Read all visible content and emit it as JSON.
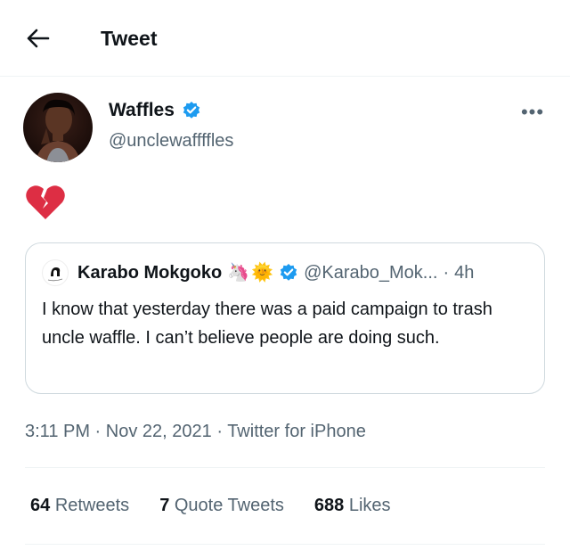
{
  "header": {
    "title": "Tweet",
    "back_icon": "arrow-left-icon"
  },
  "tweet": {
    "author": {
      "name": "Waffles",
      "handle": "@unclewaffffles",
      "verified": true
    },
    "text": "💔",
    "more_icon": "more-horizontal-icon",
    "more_label": "•••",
    "quote": {
      "name": "Karabo Mokgoko",
      "emojis": [
        "🦄",
        "🌞"
      ],
      "verified": true,
      "handle": "@Karabo_Mok...",
      "separator": "·",
      "time": "4h",
      "text": "I know that yesterday there was a paid campaign to trash uncle waffle. I can’t believe people are doing such."
    },
    "meta": {
      "time": "3:11 PM",
      "sep1": " · ",
      "date": "Nov 22, 2021",
      "sep2": " · ",
      "source": "Twitter for iPhone"
    },
    "stats": {
      "retweets_count": "64",
      "retweets_label": "Retweets",
      "quotes_count": "7",
      "quotes_label": "Quote Tweets",
      "likes_count": "688",
      "likes_label": "Likes"
    }
  },
  "colors": {
    "accent": "#1d9bf0",
    "text": "#0f1419",
    "secondary": "#536471",
    "border": "#cfd9de"
  }
}
